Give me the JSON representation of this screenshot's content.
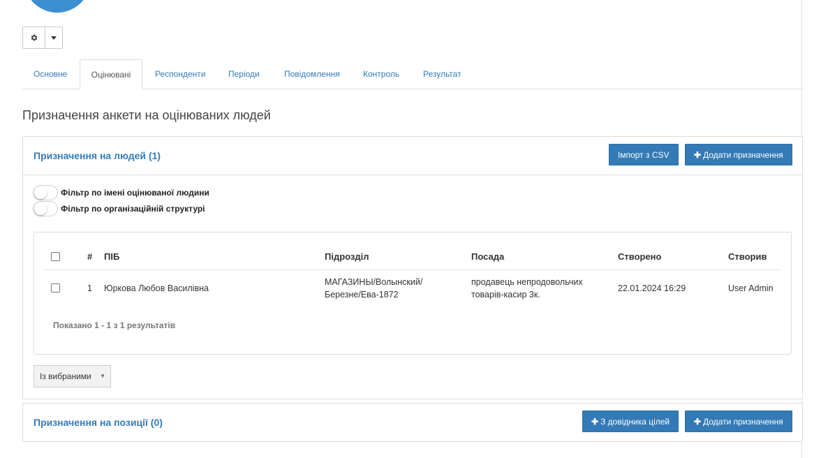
{
  "toolbar": {
    "gear_icon": "gear-icon",
    "caret_icon": "caret-down-icon"
  },
  "tabs": [
    {
      "label": "Основне"
    },
    {
      "label": "Оцінювані"
    },
    {
      "label": "Респонденти"
    },
    {
      "label": "Періоди"
    },
    {
      "label": "Повідомлення"
    },
    {
      "label": "Контроль"
    },
    {
      "label": "Результат"
    }
  ],
  "page": {
    "title": "Призначення анкети на оцінюваних людей"
  },
  "people_panel": {
    "title": "Призначення на людей (1)",
    "import_button": "Імпорт з CSV",
    "add_button": "Додати призначення",
    "filters": [
      {
        "label": "Фільтр по імені оцінюваної людини"
      },
      {
        "label": "Фільтр по організаційній структурі"
      }
    ],
    "table": {
      "headers": {
        "num": "#",
        "name": "ПІБ",
        "dept": "Підрозділ",
        "position": "Посада",
        "created": "Створено",
        "created_by": "Створив"
      },
      "rows": [
        {
          "num": "1",
          "name": "Юркова Любов Василівна",
          "dept_line1": "МАГАЗИНЫ/Волынский/",
          "dept_line2": "Березне/Ева-1872",
          "position_line1": "продавець непродовольчих",
          "position_line2": "товарів-касир 3к.",
          "created": "22.01.2024 16:29",
          "created_by": "User Admin"
        }
      ],
      "footer": "Показано 1 - 1 з 1 результатів"
    },
    "bulk_select": "Із вибраними"
  },
  "positions_panel": {
    "title": "Призначення на позиції (0)",
    "goals_button": "З довідника цілей",
    "add_button": "Додати призначення"
  },
  "colors": {
    "accent": "#337ab7",
    "avatar": "#3b8fd3"
  }
}
